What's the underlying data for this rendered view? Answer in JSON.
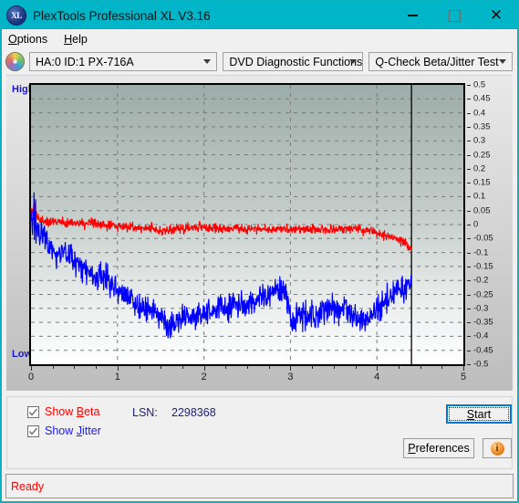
{
  "window": {
    "title": "PlexTools Professional XL V3.16",
    "icon": "xl-app-icon",
    "minimize": "—",
    "maximize": "□",
    "close": "✕"
  },
  "menubar": {
    "items": [
      {
        "label": "Options",
        "accel": "O"
      },
      {
        "label": "Help",
        "accel": "H"
      }
    ]
  },
  "toolbar": {
    "drive_icon": "optical-disc-icon",
    "drive_select": "HA:0 ID:1  PX-716A",
    "function_select": "DVD Diagnostic Functions",
    "test_select": "Q-Check Beta/Jitter Test"
  },
  "chart_panel": {
    "high_label": "High",
    "low_label": "Low"
  },
  "controls": {
    "show_beta_label": "Show Beta",
    "show_beta_checked": true,
    "show_jitter_label": "Show Jitter",
    "show_jitter_checked": true,
    "lsn_label": "LSN:",
    "lsn_value": "2298368",
    "start_label": "Start",
    "preferences_label": "Preferences",
    "info_label": "i"
  },
  "statusbar": {
    "text": "Ready"
  },
  "colors": {
    "titlebar": "#00b5c8",
    "beta_series": "#ff0000",
    "jitter_series": "#0000ff",
    "axis_label": "#1818c8",
    "status_text": "#ff0000",
    "focus_border": "#0078d7"
  },
  "chart_data": {
    "type": "line",
    "title": "Q-Check Beta/Jitter Test",
    "xlabel": "",
    "ylabel": "",
    "xlim": [
      0,
      5
    ],
    "ylim": [
      -0.5,
      0.5
    ],
    "grid": true,
    "legend_position": "bottom-left",
    "x_ticks": [
      "0",
      "1",
      "2",
      "3",
      "4",
      "5"
    ],
    "y_ticks": [
      "0.5",
      "0.45",
      "0.4",
      "0.35",
      "0.3",
      "0.25",
      "0.2",
      "0.15",
      "0.1",
      "0.05",
      "0",
      "-0.05",
      "-0.1",
      "-0.15",
      "-0.2",
      "-0.25",
      "-0.3",
      "-0.35",
      "-0.4",
      "-0.45",
      "-0.5"
    ],
    "y_axis_high_label": "High",
    "y_axis_low_label": "Low",
    "data_end_x": 4.4,
    "noise_amplitude": {
      "beta": 0.012,
      "jitter": 0.035
    },
    "series": [
      {
        "name": "Beta",
        "color": "#ff0000",
        "x": [
          0.0,
          0.05,
          0.1,
          0.15,
          0.2,
          0.3,
          0.4,
          0.5,
          0.6,
          0.7,
          0.8,
          0.9,
          1.0,
          1.1,
          1.2,
          1.3,
          1.4,
          1.5,
          1.6,
          1.7,
          1.8,
          1.9,
          2.0,
          2.1,
          2.2,
          2.3,
          2.4,
          2.5,
          2.6,
          2.7,
          2.8,
          2.9,
          3.0,
          3.1,
          3.2,
          3.3,
          3.4,
          3.5,
          3.6,
          3.7,
          3.8,
          3.9,
          4.0,
          4.1,
          4.2,
          4.3,
          4.35,
          4.4
        ],
        "y": [
          0.055,
          0.03,
          0.018,
          0.014,
          0.012,
          0.01,
          0.008,
          0.006,
          0.004,
          0.002,
          0.0,
          -0.002,
          -0.004,
          -0.008,
          -0.01,
          -0.012,
          -0.012,
          -0.024,
          -0.02,
          -0.016,
          -0.012,
          -0.01,
          -0.01,
          -0.012,
          -0.014,
          -0.014,
          -0.014,
          -0.015,
          -0.016,
          -0.016,
          -0.016,
          -0.016,
          -0.017,
          -0.018,
          -0.018,
          -0.018,
          -0.018,
          -0.018,
          -0.016,
          -0.014,
          -0.018,
          -0.022,
          -0.03,
          -0.038,
          -0.048,
          -0.062,
          -0.075,
          -0.092
        ]
      },
      {
        "name": "Jitter",
        "color": "#0000ff",
        "x": [
          0.0,
          0.03,
          0.06,
          0.1,
          0.15,
          0.2,
          0.25,
          0.3,
          0.35,
          0.4,
          0.45,
          0.5,
          0.55,
          0.6,
          0.65,
          0.7,
          0.75,
          0.8,
          0.85,
          0.9,
          0.95,
          1.0,
          1.05,
          1.1,
          1.15,
          1.2,
          1.25,
          1.3,
          1.35,
          1.4,
          1.45,
          1.5,
          1.55,
          1.6,
          1.65,
          1.7,
          1.75,
          1.8,
          1.85,
          1.9,
          1.95,
          2.0,
          2.1,
          2.2,
          2.3,
          2.4,
          2.5,
          2.6,
          2.7,
          2.8,
          2.9,
          2.95,
          3.0,
          3.05,
          3.1,
          3.2,
          3.3,
          3.4,
          3.5,
          3.6,
          3.7,
          3.8,
          3.9,
          4.0,
          4.1,
          4.2,
          4.3,
          4.4
        ],
        "y": [
          0.06,
          0.02,
          -0.01,
          -0.035,
          -0.055,
          -0.07,
          -0.085,
          -0.095,
          -0.11,
          -0.1,
          -0.115,
          -0.13,
          -0.145,
          -0.15,
          -0.16,
          -0.175,
          -0.185,
          -0.175,
          -0.19,
          -0.21,
          -0.225,
          -0.235,
          -0.25,
          -0.24,
          -0.255,
          -0.275,
          -0.29,
          -0.3,
          -0.29,
          -0.305,
          -0.32,
          -0.33,
          -0.345,
          -0.36,
          -0.355,
          -0.34,
          -0.33,
          -0.32,
          -0.325,
          -0.33,
          -0.325,
          -0.318,
          -0.31,
          -0.3,
          -0.295,
          -0.285,
          -0.29,
          -0.27,
          -0.258,
          -0.245,
          -0.235,
          -0.24,
          -0.345,
          -0.34,
          -0.33,
          -0.325,
          -0.315,
          -0.31,
          -0.3,
          -0.305,
          -0.32,
          -0.335,
          -0.34,
          -0.31,
          -0.275,
          -0.25,
          -0.235,
          -0.225
        ]
      }
    ]
  }
}
